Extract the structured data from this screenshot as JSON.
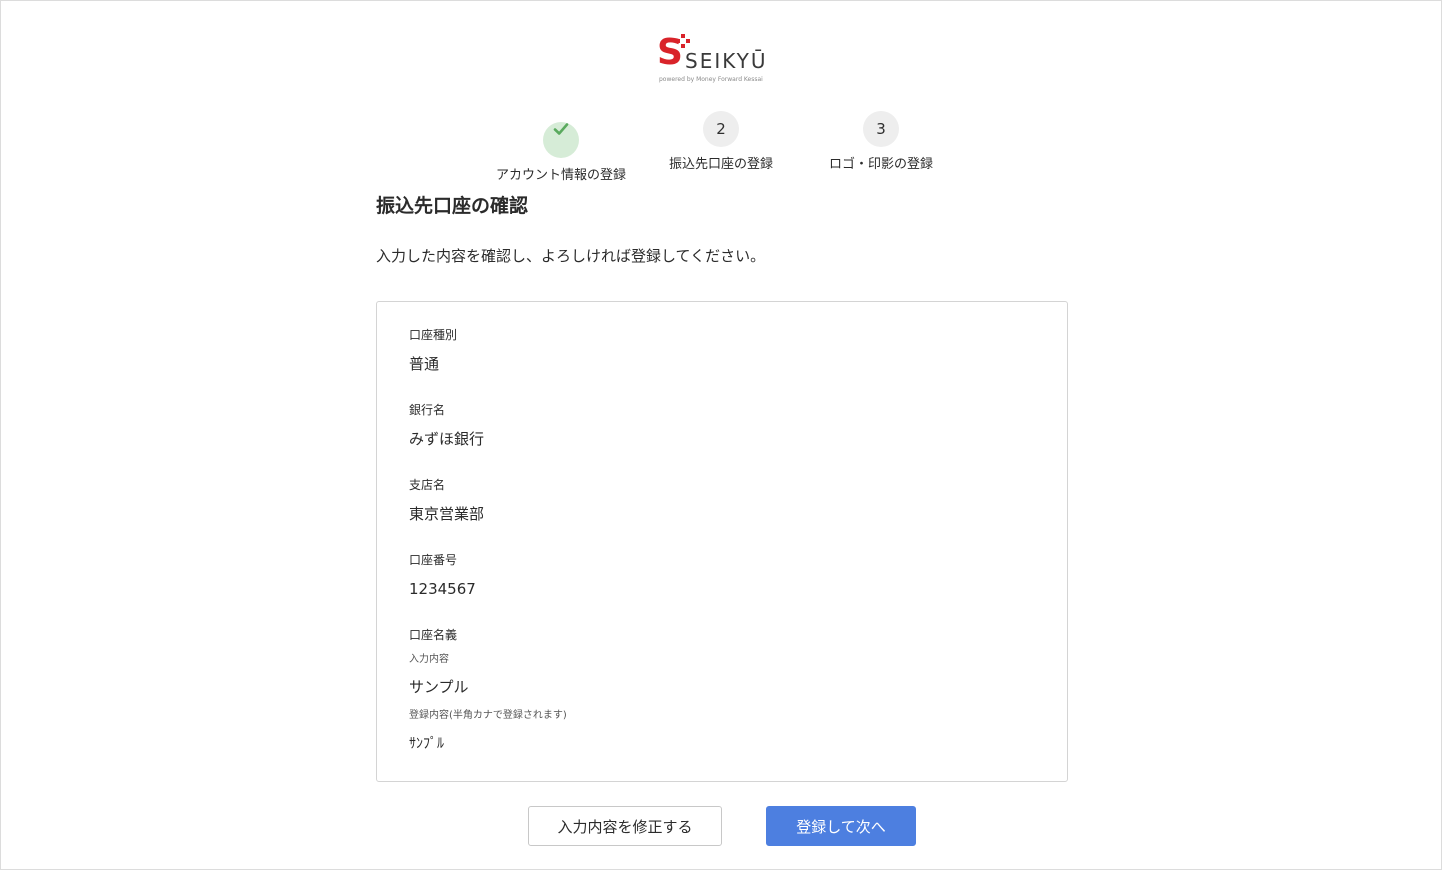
{
  "logo": {
    "mark": "S",
    "wordmark": "SEIKYŪ",
    "tagline": "powered by Money Forward Kessai"
  },
  "stepper": {
    "steps": [
      {
        "number": "1",
        "label": "アカウント情報の登録",
        "status": "completed",
        "icon": "check-icon"
      },
      {
        "number": "2",
        "label": "振込先口座の登録",
        "status": "current"
      },
      {
        "number": "3",
        "label": "ロゴ・印影の登録",
        "status": "upcoming"
      }
    ]
  },
  "page": {
    "title": "振込先口座の確認",
    "description": "入力した内容を確認し、よろしければ登録してください。"
  },
  "account": {
    "type_label": "口座種別",
    "type_value": "普通",
    "bank_label": "銀行名",
    "bank_value": "みずほ銀行",
    "branch_label": "支店名",
    "branch_value": "東京営業部",
    "number_label": "口座番号",
    "number_value": "1234567",
    "holder_label": "口座名義",
    "holder_input_label": "入力内容",
    "holder_input_value": "サンプル",
    "holder_registered_label": "登録内容(半角カナで登録されます)",
    "holder_registered_value": "ｻﾝﾌﾟﾙ"
  },
  "actions": {
    "edit_label": "入力内容を修正する",
    "submit_label": "登録して次へ"
  },
  "colors": {
    "brand_red": "#d9232a",
    "primary_button": "#4d7fe0",
    "step_done_bg": "#d6ecd7",
    "step_done_check": "#5aaa5e",
    "step_pending_bg": "#eeeeee"
  }
}
